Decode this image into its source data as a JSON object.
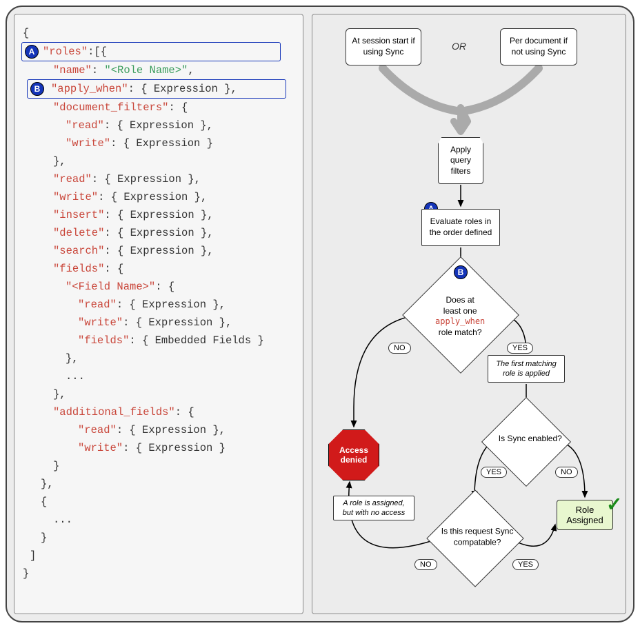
{
  "code": {
    "open_brace": "{",
    "roles_key": "\"roles\"",
    "roles_open": ":[{",
    "name_key": "\"name\"",
    "name_val": "\"<Role Name>\"",
    "apply_when_key": "\"apply_when\"",
    "expr": "{ Expression }",
    "doc_filters_key": "\"document_filters\"",
    "read_key": "\"read\"",
    "write_key": "\"write\"",
    "insert_key": "\"insert\"",
    "delete_key": "\"delete\"",
    "search_key": "\"search\"",
    "fields_key": "\"fields\"",
    "field_name_key": "\"<Field Name>\"",
    "embedded": "{ Embedded Fields }",
    "ellipsis": "...",
    "additional_fields_key": "\"additional_fields\"",
    "close_brace": "}",
    "close_brace_comma": "},",
    "close_bracket": "]",
    "comma": ",",
    "colon": ": ",
    "colon_brace": ": {",
    "open_brace_only": "{"
  },
  "badges": {
    "a": "A",
    "b": "B"
  },
  "flowchart": {
    "start_left": "At session start if using Sync",
    "start_right": "Per document if not using Sync",
    "or": "OR",
    "apply_filters": "Apply query filters",
    "eval_roles": "Evaluate roles in the order defined",
    "decision1_line1": "Does at",
    "decision1_line2": "least one",
    "decision1_apply": "apply_when",
    "decision1_line3": "role match?",
    "yes": "YES",
    "no": "NO",
    "first_match": "The first matching role is applied",
    "sync_enabled": "Is Sync enabled?",
    "access_denied": "Access denied",
    "no_access_note": "A role is assigned, but with no access",
    "sync_compat": "Is this request Sync compatable?",
    "role_assigned": "Role Assigned",
    "check": "✓"
  }
}
